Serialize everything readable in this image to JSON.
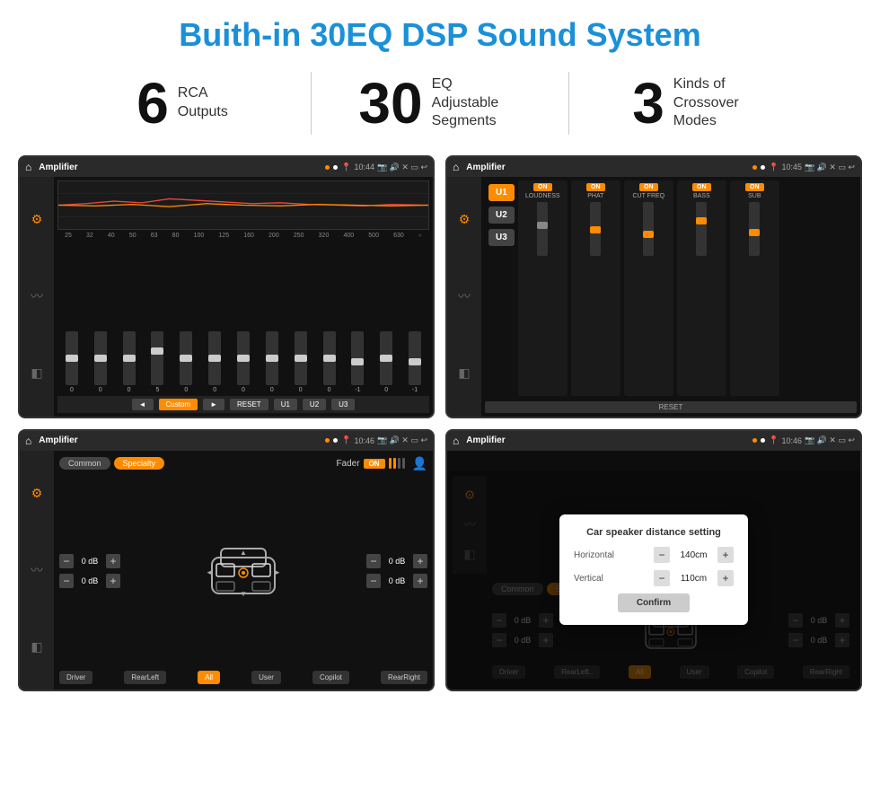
{
  "header": {
    "title": "Buith-in 30EQ DSP Sound System"
  },
  "stats": [
    {
      "number": "6",
      "label_line1": "RCA",
      "label_line2": "Outputs"
    },
    {
      "number": "30",
      "label_line1": "EQ Adjustable",
      "label_line2": "Segments"
    },
    {
      "number": "3",
      "label_line1": "Kinds of",
      "label_line2": "Crossover Modes"
    }
  ],
  "screens": {
    "eq": {
      "title": "Amplifier",
      "time": "10:44",
      "freq_labels": [
        "25",
        "32",
        "40",
        "50",
        "63",
        "80",
        "100",
        "125",
        "160",
        "200",
        "250",
        "320",
        "400",
        "500",
        "630"
      ],
      "slider_values": [
        "0",
        "0",
        "0",
        "5",
        "0",
        "0",
        "0",
        "0",
        "0",
        "0",
        "-1",
        "0",
        "-1"
      ],
      "buttons": [
        "Custom",
        "RESET",
        "U1",
        "U2",
        "U3"
      ]
    },
    "amp": {
      "title": "Amplifier",
      "time": "10:45",
      "channels": [
        {
          "name": "LOUDNESS",
          "on": true
        },
        {
          "name": "PHAT",
          "on": true
        },
        {
          "name": "CUT FREQ",
          "on": true
        },
        {
          "name": "BASS",
          "on": true
        },
        {
          "name": "SUB",
          "on": true
        }
      ],
      "u_buttons": [
        "U1",
        "U2",
        "U3"
      ],
      "reset_label": "RESET"
    },
    "fader": {
      "title": "Amplifier",
      "time": "10:46",
      "tabs": [
        "Common",
        "Specialty"
      ],
      "fader_label": "Fader",
      "on_label": "ON",
      "db_values": [
        "0 dB",
        "0 dB",
        "0 dB",
        "0 dB"
      ],
      "bottom_buttons": [
        "Driver",
        "RearLeft",
        "All",
        "User",
        "Copilot",
        "RearRight"
      ]
    },
    "dialog": {
      "title": "Amplifier",
      "time": "10:46",
      "dialog_title": "Car speaker distance setting",
      "horizontal_label": "Horizontal",
      "horizontal_value": "140cm",
      "vertical_label": "Vertical",
      "vertical_value": "110cm",
      "confirm_label": "Confirm",
      "db_right_values": [
        "0 dB",
        "0 dB"
      ],
      "bottom_buttons": [
        "Driver",
        "RearLeft..",
        "All",
        "User",
        "Copilot",
        "RearRight"
      ]
    }
  }
}
